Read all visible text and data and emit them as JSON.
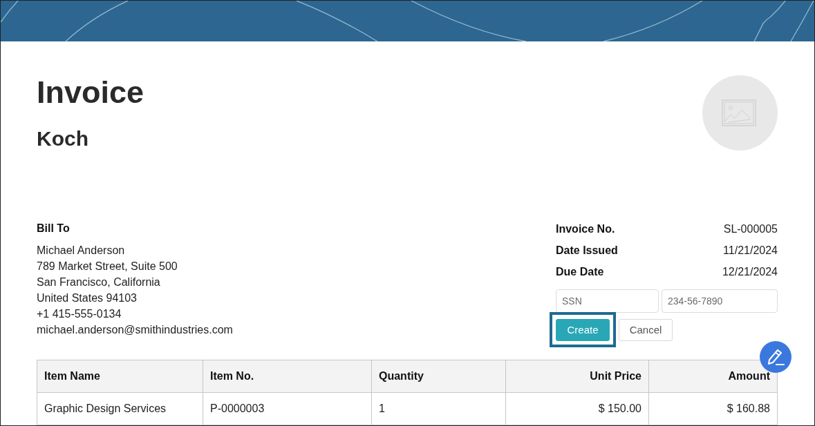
{
  "header": {
    "title": "Invoice",
    "company": "Koch"
  },
  "bill_to": {
    "heading": "Bill To",
    "lines": [
      "Michael Anderson",
      "789 Market Street, Suite 500",
      "San Francisco, California",
      "United States 94103",
      "+1 415-555-0134",
      "michael.anderson@smithindustries.com"
    ]
  },
  "invoice_details": [
    {
      "label": "Invoice No.",
      "value": "SL-000005"
    },
    {
      "label": "Date Issued",
      "value": "11/21/2024"
    },
    {
      "label": "Due Date",
      "value": "12/21/2024"
    }
  ],
  "custom_field_form": {
    "fields": [
      {
        "placeholder": "SSN"
      },
      {
        "placeholder": "234-56-7890"
      }
    ],
    "buttons": [
      {
        "label": "Create",
        "kind": "primary",
        "highlighted": true
      },
      {
        "label": "Cancel",
        "kind": "secondary",
        "highlighted": false
      }
    ]
  },
  "table": {
    "columns": [
      {
        "label": "Item Name",
        "kind": "text"
      },
      {
        "label": "Item No.",
        "kind": "text"
      },
      {
        "label": "Quantity",
        "kind": "text"
      },
      {
        "label": "Unit Price",
        "kind": "currency"
      },
      {
        "label": "Amount",
        "kind": "currency"
      }
    ],
    "rows": [
      [
        "Graphic Design Services",
        "P-0000003",
        "1",
        "$ 150.00",
        "$ 160.88"
      ]
    ]
  }
}
